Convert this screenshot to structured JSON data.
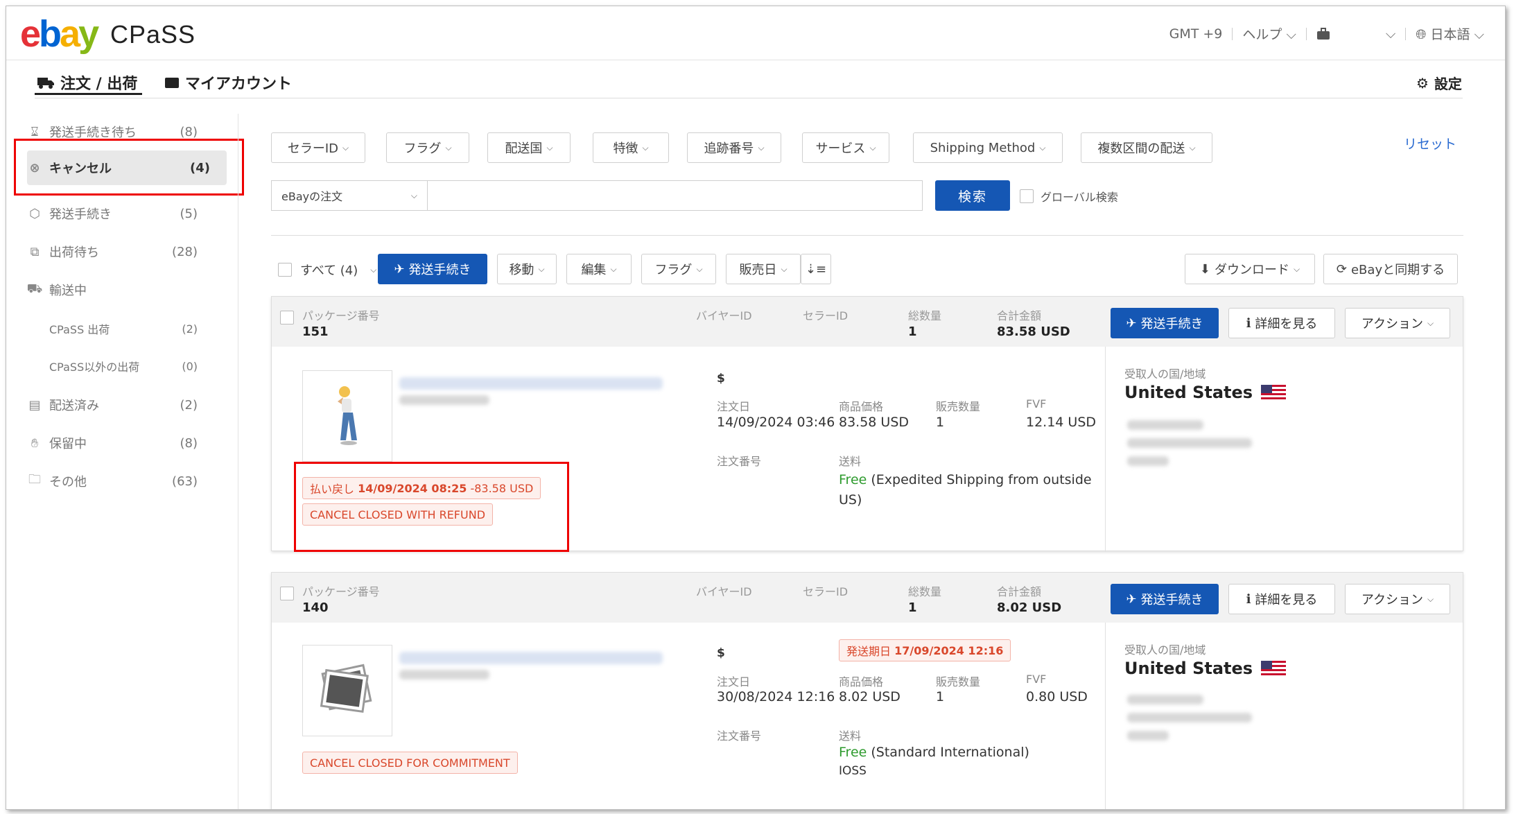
{
  "header": {
    "logo": "ebay",
    "product": "CPaSS",
    "timezone": "GMT +9",
    "help": "ヘルプ",
    "language": "日本語"
  },
  "nav": {
    "orders_tab": "注文 / 出荷",
    "account_tab": "マイアカウント",
    "settings": "設定"
  },
  "sidebar": {
    "items": [
      {
        "label": "発送手続き待ち",
        "count": "(8)",
        "icon": "hourglass-icon"
      },
      {
        "label": "キャンセル",
        "count": "(4)",
        "icon": "cancel-circle-icon"
      },
      {
        "label": "発送手続き",
        "count": "(5)",
        "icon": "box-icon"
      },
      {
        "label": "出荷待ち",
        "count": "(28)",
        "icon": "package-wait-icon"
      },
      {
        "label": "輸送中",
        "count": "",
        "icon": "truck-icon"
      },
      {
        "label": "CPaSS 出荷",
        "count": "(2)",
        "icon": ""
      },
      {
        "label": "CPaSS以外の出荷",
        "count": "(0)",
        "icon": ""
      },
      {
        "label": "配送済み",
        "count": "(2)",
        "icon": "delivered-icon"
      },
      {
        "label": "保留中",
        "count": "(8)",
        "icon": "hand-icon"
      },
      {
        "label": "その他",
        "count": "(63)",
        "icon": "folder-icon"
      }
    ]
  },
  "filters": {
    "seller_id": "セラーID",
    "flag": "フラグ",
    "country": "配送国",
    "feature": "特徴",
    "tracking": "追跡番号",
    "service": "サービス",
    "shipping_method": "Shipping Method",
    "multi_leg": "複数区間の配送",
    "reset": "リセット",
    "search_type": "eBayの注文",
    "search_btn": "検索",
    "global_search": "グローバル検索"
  },
  "toolbar": {
    "all": "すべて (4)",
    "ship": "発送手続き",
    "move": "移動",
    "edit": "編集",
    "flag": "フラグ",
    "sale_date": "販売日",
    "download": "ダウンロード",
    "sync": "eBayと同期する"
  },
  "labels": {
    "package_no": "パッケージ番号",
    "buyer_id": "バイヤーID",
    "seller_id": "セラーID",
    "total_qty": "総数量",
    "total_amount": "合計金額",
    "ship_btn": "発送手続き",
    "details_btn": "詳細を見る",
    "action_btn": "アクション",
    "order_date": "注文日",
    "item_price": "商品価格",
    "sold_qty": "販売数量",
    "fvf": "FVF",
    "order_no": "注文番号",
    "shipping": "送料",
    "recipient_country": "受取人の国/地域"
  },
  "packages": [
    {
      "number": "151",
      "qty": "1",
      "amount": "83.58 USD",
      "currency": "$",
      "order_date": "14/09/2024 03:46",
      "item_price": "83.58 USD",
      "sold_qty": "1",
      "fvf": "12.14 USD",
      "ship_free": "Free",
      "ship_service": " (Expedited Shipping from outside US)",
      "country": "United States",
      "refund_label": "払い戻し",
      "refund_date": "14/09/2024 08:25",
      "refund_amount": "-83.58 USD",
      "status": "CANCEL CLOSED WITH REFUND"
    },
    {
      "number": "140",
      "qty": "1",
      "amount": "8.02 USD",
      "currency": "$",
      "ship_by_label": "発送期日",
      "ship_by": "17/09/2024 12:16",
      "order_date": "30/08/2024 12:16",
      "item_price": "8.02 USD",
      "sold_qty": "1",
      "fvf": "0.80 USD",
      "ship_free": "Free",
      "ship_service": " (Standard International)",
      "ship_extra": "IOSS",
      "country": "United States",
      "status": "CANCEL CLOSED FOR COMMITMENT"
    }
  ],
  "colors": {
    "primary": "#1557b4",
    "alert": "#d9472b",
    "highlight_box": "#e00000",
    "free": "#2e9b2e"
  }
}
